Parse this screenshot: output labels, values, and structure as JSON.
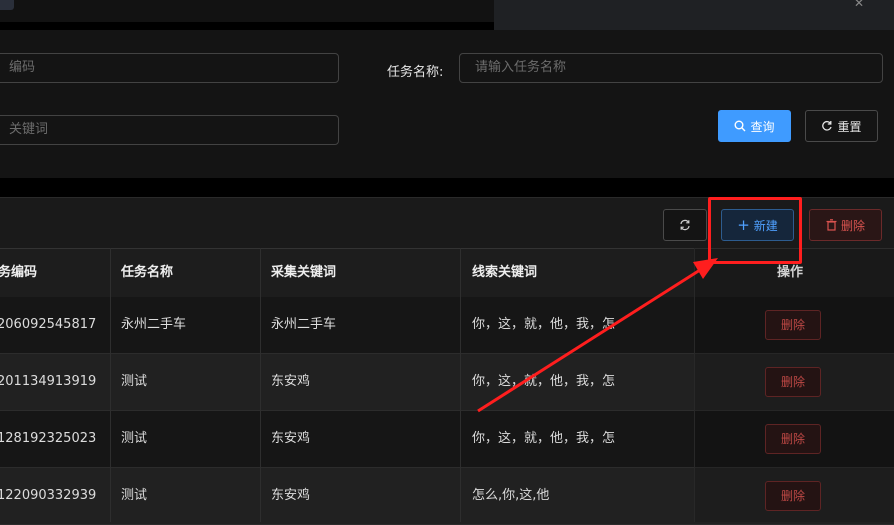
{
  "filters": {
    "task_code_placeholder": "编码",
    "task_name_label": "任务名称:",
    "task_name_placeholder": "请输入任务名称",
    "keyword_placeholder": "关键词",
    "query_label": "查询",
    "reset_label": "重置"
  },
  "toolbar": {
    "new_label": "新建",
    "delete_label": "删除"
  },
  "table": {
    "columns": [
      "务编码",
      "任务名称",
      "采集关键词",
      "线索关键词",
      "操作"
    ],
    "rows": [
      {
        "code": "206092545817",
        "name": "永州二手车",
        "collect": "永州二手车",
        "clue": "你，这，就，他，我，怎",
        "action": "删除"
      },
      {
        "code": "201134913919",
        "name": "测试",
        "collect": "东安鸡",
        "clue": "你，这，就，他，我，怎",
        "action": "删除"
      },
      {
        "code": "128192325023",
        "name": "测试",
        "collect": "东安鸡",
        "clue": "你，这，就，他，我，怎",
        "action": "删除"
      },
      {
        "code": "122090332939",
        "name": "测试",
        "collect": "东安鸡",
        "clue": "怎么,你,这,他",
        "action": "删除"
      }
    ]
  },
  "annotation": {
    "color": "#ff1e1e"
  },
  "icons": [
    "search-icon",
    "reload-icon",
    "refresh-icon",
    "plus-icon",
    "trash-icon",
    "close-icon"
  ]
}
